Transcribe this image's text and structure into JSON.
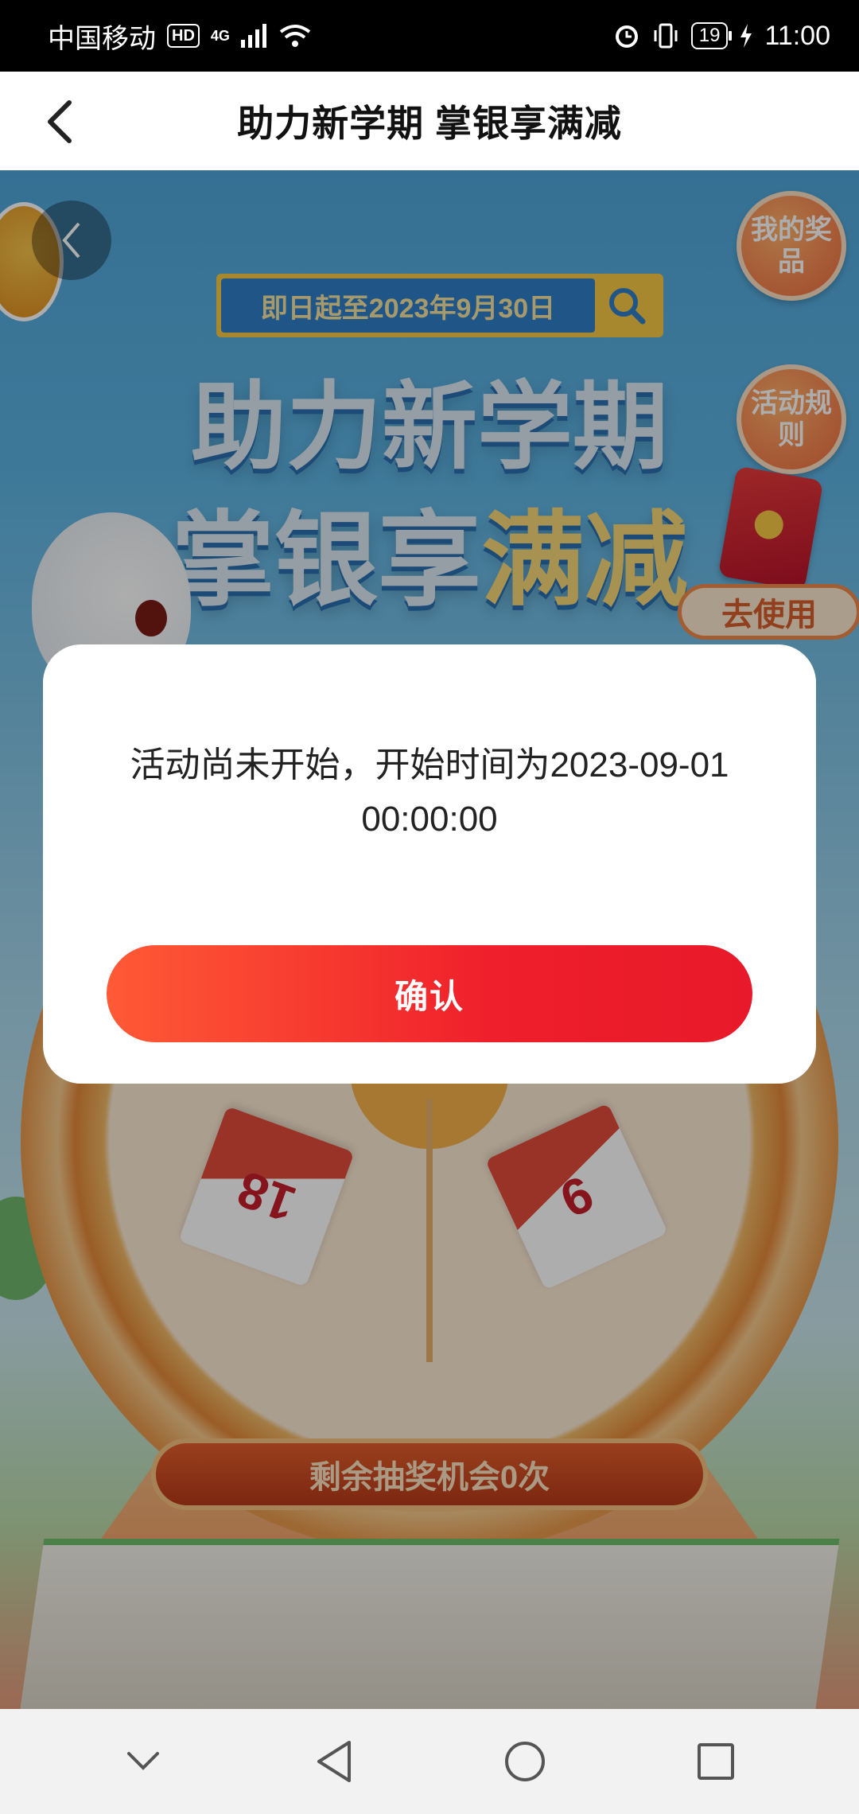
{
  "status_bar": {
    "carrier": "中国移动",
    "hd": "HD",
    "network": "4G",
    "battery": "19",
    "time": "11:00"
  },
  "header": {
    "title": "助力新学期 掌银享满减"
  },
  "banner": {
    "date_range": "即日起至2023年9月30日",
    "headline_line1": "助力新学期",
    "headline_line2a": "掌银享",
    "headline_line2b": "满减",
    "my_prizes": "我的奖品",
    "rules": "活动规则",
    "use_button": "去使用",
    "prize_left": "18",
    "prize_right": "9",
    "chances": "剩余抽奖机会0次"
  },
  "dialog": {
    "message": "活动尚未开始，开始时间为2023-09-01 00:00:00",
    "confirm_label": "确认"
  },
  "colors": {
    "accent_start": "#ff5a36",
    "accent_end": "#e8192a"
  }
}
